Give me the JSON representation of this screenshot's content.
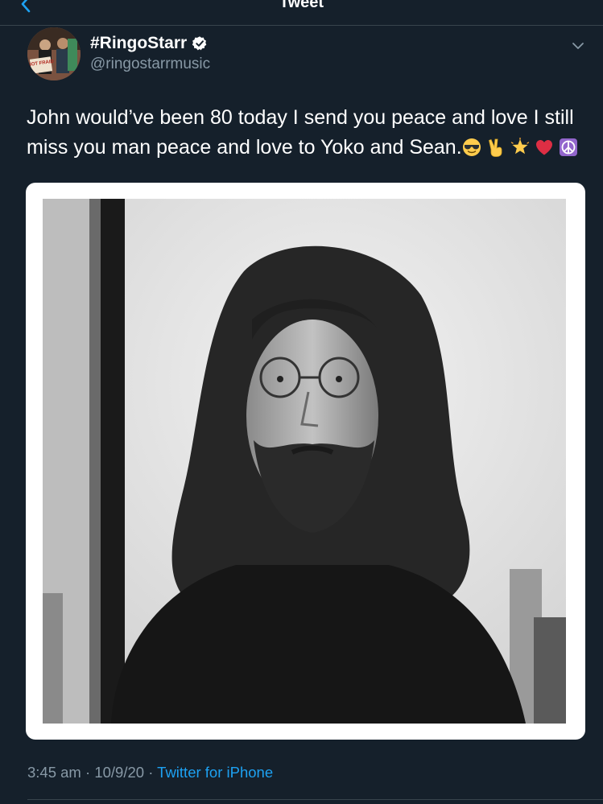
{
  "header": {
    "title": "Tweet"
  },
  "tweet": {
    "author_name": "#RingoStarr",
    "author_handle": "@ringostarrmusic",
    "avatar_sign_text": "NOT FRAID",
    "text": "John would’ve been 80 today I send you peace and love I still miss you man peace and love to Yoko and Sean.",
    "emojis": [
      "sunglasses-face",
      "victory-hand",
      "glowing-star",
      "red-heart",
      "peace-symbol"
    ],
    "time": "3:45 am",
    "date": "10/9/20",
    "separator": "·",
    "source": "Twitter for iPhone"
  },
  "colors": {
    "background": "#15202b",
    "accent": "#1da1f2",
    "secondary_text": "#8899a6",
    "divider": "#38444d"
  }
}
